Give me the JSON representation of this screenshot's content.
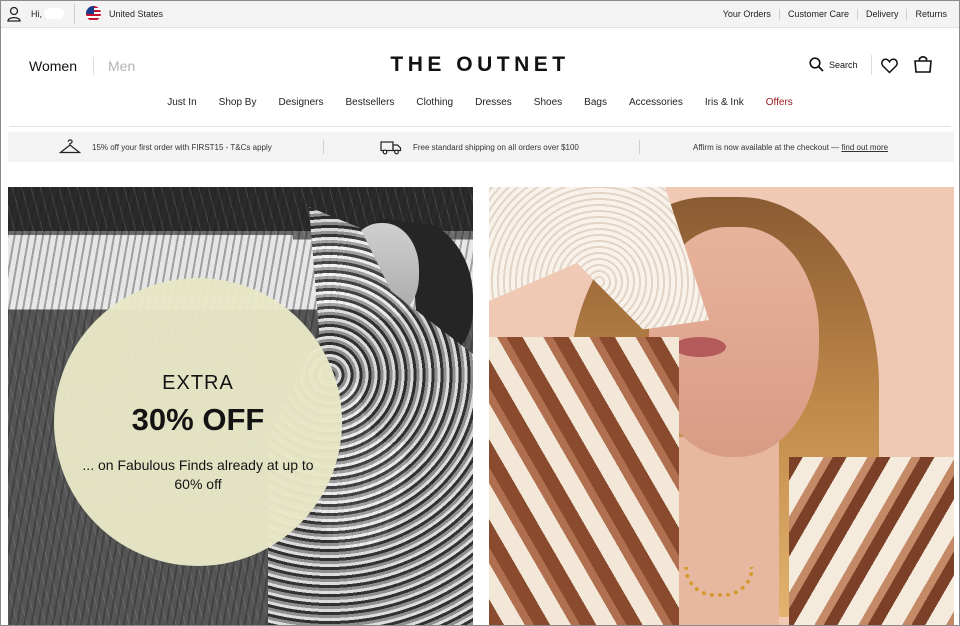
{
  "topbar": {
    "greeting": "Hi,",
    "country": "United States",
    "links": [
      "Your Orders",
      "Customer Care",
      "Delivery",
      "Returns"
    ]
  },
  "header": {
    "women": "Women",
    "men": "Men",
    "logo": "THE OUTNET",
    "search_label": "Search"
  },
  "nav": {
    "items": [
      "Just In",
      "Shop By",
      "Designers",
      "Bestsellers",
      "Clothing",
      "Dresses",
      "Shoes",
      "Bags",
      "Accessories",
      "Iris & Ink",
      "Offers"
    ]
  },
  "promo": {
    "first_order": "15% off your first order with FIRST15 - T&Cs apply",
    "shipping": "Free standard shipping on all orders over $100",
    "affirm_text": "Affirm is now available at the checkout —",
    "affirm_link": "find out more"
  },
  "hero": {
    "extra": "EXTRA",
    "discount": "30% OFF",
    "subtitle": "... on Fabulous Finds already at up to 60% off"
  },
  "colors": {
    "offers": "#9b1c23",
    "promo_circle": "#e8e8c8",
    "right_background": "#f0c9b4"
  }
}
